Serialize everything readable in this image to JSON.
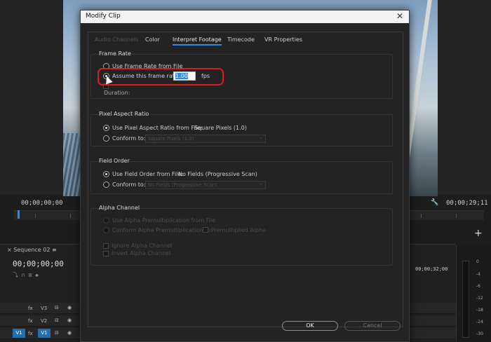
{
  "program": {
    "timecode_left": "00;00;00;00",
    "timecode_right": "00;00;29;11",
    "sequence_tab": "Sequence 02",
    "sequence_timecode": "00;00;00;00",
    "ruler_timecode": "00;00;32;00",
    "tracks": [
      {
        "name": "V3"
      },
      {
        "name": "V2"
      },
      {
        "name": "V1",
        "source": "V1"
      }
    ],
    "meter_labels": [
      "0",
      "-4",
      "-6",
      "-12",
      "-18",
      "-24",
      "-30"
    ]
  },
  "dialog": {
    "title": "Modify Clip",
    "tabs": [
      "Audio Channels",
      "Color",
      "Interpret Footage",
      "Timecode",
      "VR Properties"
    ],
    "active_tab": "Interpret Footage",
    "frame_rate": {
      "title": "Frame Rate",
      "use_from_file": "Use Frame Rate from File",
      "assume_label": "Assume this frame rate:",
      "assume_value": "1.00",
      "unit": "fps",
      "duration_label": "Duration:"
    },
    "pixel_aspect": {
      "title": "Pixel Aspect Ratio",
      "use_from_file": "Use Pixel Aspect Ratio from File:",
      "from_file_value": "Square Pixels (1.0)",
      "conform_label": "Conform to:",
      "conform_value": "Square Pixels (1.0)"
    },
    "field_order": {
      "title": "Field Order",
      "use_from_file": "Use Field Order from File:",
      "from_file_value": "No Fields (Progressive Scan)",
      "conform_label": "Conform to:",
      "conform_value": "No Fields (Progressive Scan)"
    },
    "alpha": {
      "title": "Alpha Channel",
      "use_premult": "Use Alpha Premultiplication from File",
      "conform_premult": "Conform Alpha Premultiplication to:",
      "premultiplied": "Premultiplied Alpha",
      "ignore": "Ignore Alpha Channel",
      "invert": "Invert Alpha Channel"
    },
    "ok_label": "OK",
    "cancel_label": "Cancel",
    "highlight_color": "#d91d1d",
    "accent_color": "#2d8ceb"
  }
}
